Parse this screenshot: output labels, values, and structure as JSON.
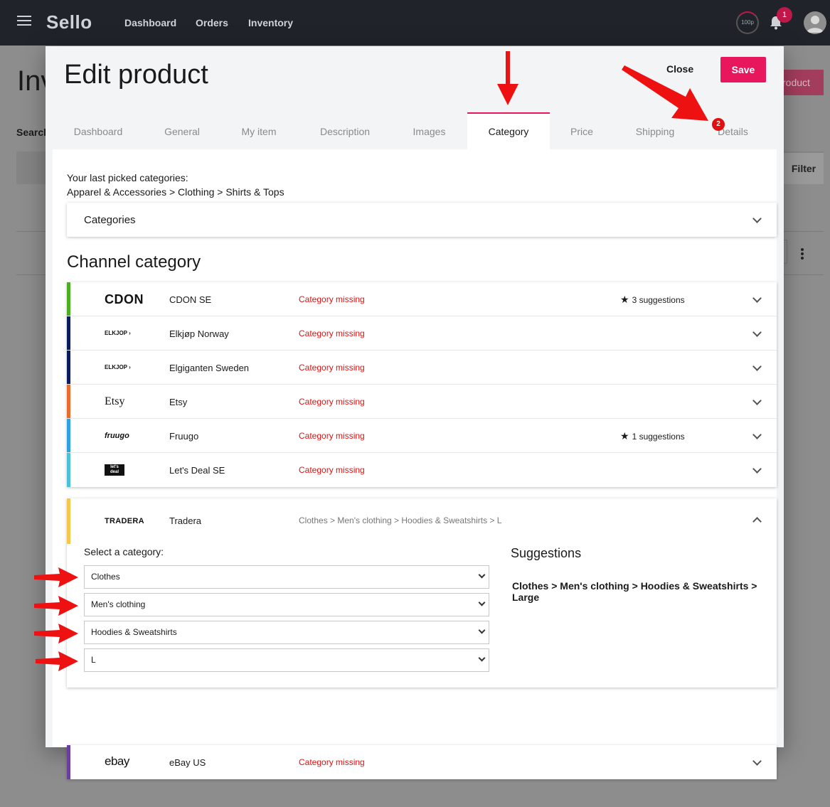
{
  "app": {
    "brand": "Sello",
    "nav": [
      "Dashboard",
      "Orders",
      "Inventory"
    ],
    "quota_label": "100p",
    "notification_count": "1"
  },
  "background_page": {
    "title": "Inv",
    "search_label": "Search",
    "add_button": "roduct",
    "filter_button": "Filter"
  },
  "modal": {
    "title": "Edit product",
    "close_label": "Close",
    "save_label": "Save",
    "tabs": [
      "Dashboard",
      "General",
      "My item",
      "Description",
      "Images",
      "Category",
      "Price",
      "Shipping",
      "Details"
    ],
    "active_tab": "Category",
    "details_badge": "2"
  },
  "category": {
    "last_picked_label": "Your last picked categories:",
    "last_picked_value": "Apparel & Accessories > Clothing > Shirts & Tops",
    "categories_panel_label": "Categories",
    "channel_heading": "Channel category",
    "channels": [
      {
        "logo": "CDON",
        "name": "CDON SE",
        "status": "Category missing",
        "suggestions": "3 suggestions",
        "color": "#4caf22"
      },
      {
        "logo": "ELKJOP",
        "name": "Elkjøp Norway",
        "status": "Category missing",
        "suggestions": "",
        "color": "#0c1a5e"
      },
      {
        "logo": "ELKJOP",
        "name": "Elgiganten Sweden",
        "status": "Category missing",
        "suggestions": "",
        "color": "#0c1a5e"
      },
      {
        "logo": "Etsy",
        "name": "Etsy",
        "status": "Category missing",
        "suggestions": "",
        "color": "#ea6b2e"
      },
      {
        "logo": "fruugo",
        "name": "Fruugo",
        "status": "Category missing",
        "suggestions": "1 suggestions",
        "color": "#2fa0e0"
      },
      {
        "logo": "let's deal",
        "name": "Let's Deal SE",
        "status": "Category missing",
        "suggestions": "",
        "color": "#4dc1d8"
      }
    ],
    "tradera": {
      "logo": "TRADERA",
      "name": "Tradera",
      "path": "Clothes > Men's clothing > Hoodies & Sweatshirts > L",
      "select_label": "Select a category:",
      "selects": [
        "Clothes",
        "Men's clothing",
        "Hoodies & Sweatshirts",
        "L"
      ],
      "suggestions_title": "Suggestions",
      "suggestion": "Clothes > Men's clothing > Hoodies & Sweatshirts > Large",
      "color": "#f5c84b"
    },
    "ebay": {
      "logo": "ebay",
      "name": "eBay US",
      "status": "Category missing",
      "color": "#6b3fa0"
    }
  }
}
